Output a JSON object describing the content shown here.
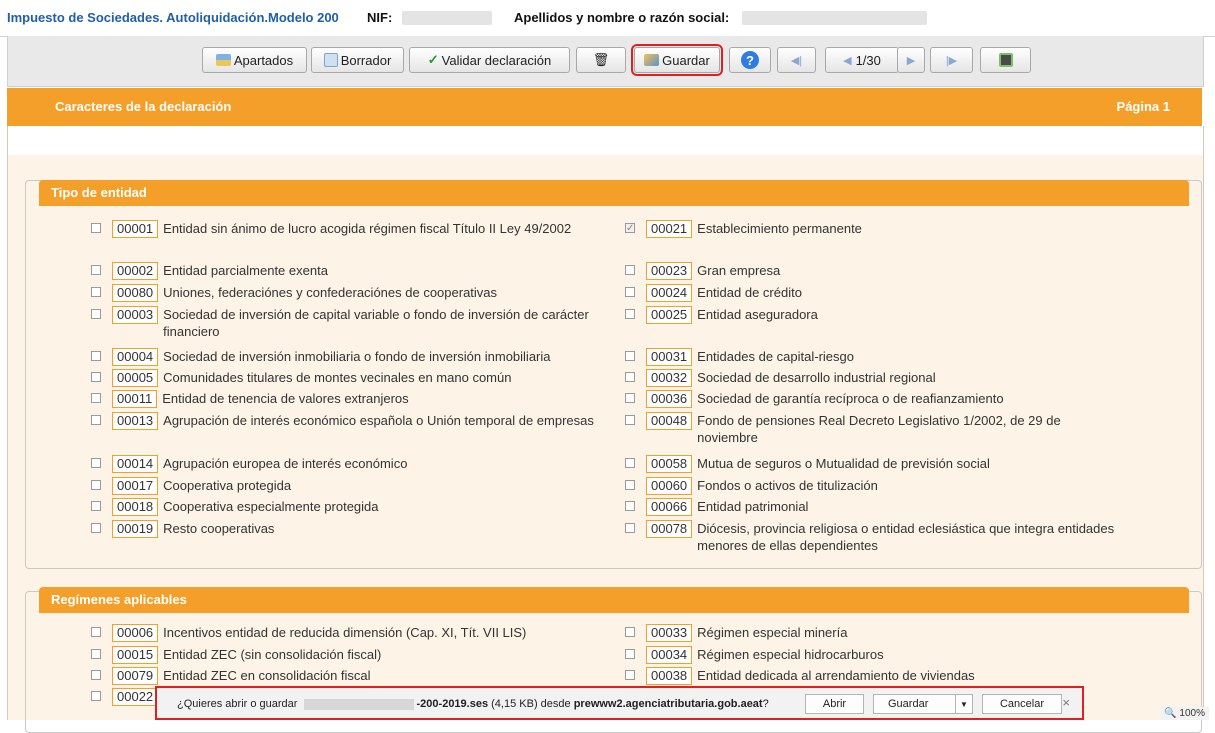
{
  "header": {
    "app_title": "Impuesto de Sociedades. Autoliquidación.Modelo 200",
    "nif_label": "NIF:",
    "name_label": "Apellidos y nombre o razón social:"
  },
  "toolbar": {
    "apartados": "Apartados",
    "borrador": "Borrador",
    "validar": "Validar declaración",
    "guardar": "Guardar",
    "page_indicator": "1/30"
  },
  "page_header": {
    "title": "Caracteres de la declaración",
    "page": "Página 1"
  },
  "sections": {
    "tipo": {
      "title": "Tipo de entidad",
      "left": [
        {
          "code": "00001",
          "label": "Entidad sin ánimo de lucro acogida régimen fiscal Título II Ley 49/2002",
          "checked": false
        },
        {
          "code": "00002",
          "label": "Entidad parcialmente exenta",
          "checked": false
        },
        {
          "code": "00080",
          "label": "Uniones, federaciónes y confederaciónes de cooperativas",
          "checked": false
        },
        {
          "code": "00003",
          "label": "Sociedad de inversión de capital variable o fondo de inversión de carácter financiero",
          "checked": false
        },
        {
          "code": "00004",
          "label": "Sociedad de inversión inmobiliaria o fondo de inversión inmobiliaria",
          "checked": false
        },
        {
          "code": "00005",
          "label": "Comunidades titulares de montes vecinales en mano común",
          "checked": false
        },
        {
          "code": "00011",
          "label": "Entidad de tenencia de valores extranjeros",
          "checked": false
        },
        {
          "code": "00013",
          "label": "Agrupación de interés económico española o Unión temporal de empresas",
          "checked": false
        },
        {
          "code": "00014",
          "label": "Agrupación europea de interés económico",
          "checked": false
        },
        {
          "code": "00017",
          "label": "Cooperativa protegida",
          "checked": false
        },
        {
          "code": "00018",
          "label": "Cooperativa especialmente protegida",
          "checked": false
        },
        {
          "code": "00019",
          "label": "Resto cooperativas",
          "checked": false
        }
      ],
      "right": [
        {
          "code": "00021",
          "label": "Establecimiento permanente",
          "checked": true
        },
        {
          "code": "00023",
          "label": "Gran empresa",
          "checked": false
        },
        {
          "code": "00024",
          "label": "Entidad de crédito",
          "checked": false
        },
        {
          "code": "00025",
          "label": "Entidad aseguradora",
          "checked": false
        },
        {
          "code": "00031",
          "label": "Entidades de capital-riesgo",
          "checked": false
        },
        {
          "code": "00032",
          "label": "Sociedad de desarrollo industrial regional",
          "checked": false
        },
        {
          "code": "00036",
          "label": "Sociedad de garantía recíproca o de reafianzamiento",
          "checked": false
        },
        {
          "code": "00048",
          "label": "Fondo de pensiones Real Decreto Legislativo 1/2002, de 29 de noviembre",
          "checked": false
        },
        {
          "code": "00058",
          "label": "Mutua de seguros o Mutualidad de previsión social",
          "checked": false
        },
        {
          "code": "00060",
          "label": "Fondos o activos de titulización",
          "checked": false
        },
        {
          "code": "00066",
          "label": "Entidad patrimonial",
          "checked": false
        },
        {
          "code": "00078",
          "label": "Diócesis, provincia religiosa o entidad eclesiástica que integra entidades menores de ellas dependientes",
          "checked": false
        }
      ]
    },
    "regimenes": {
      "title": "Regímenes aplicables",
      "left": [
        {
          "code": "00006",
          "label": "Incentivos entidad de reducida dimensión (Cap. XI, Tít. VII LIS)",
          "checked": false
        },
        {
          "code": "00015",
          "label": "Entidad ZEC (sin consolidación fiscal)",
          "checked": false
        },
        {
          "code": "00079",
          "label": "Entidad ZEC en consolidación fiscal",
          "checked": false
        },
        {
          "code": "00022",
          "label": "",
          "checked": false
        }
      ],
      "right": [
        {
          "code": "00033",
          "label": "Régimen especial minería",
          "checked": false
        },
        {
          "code": "00034",
          "label": "Régimen especial hidrocarburos",
          "checked": false
        },
        {
          "code": "00038",
          "label": "Entidad dedicada al arrendamiento de viviendas",
          "checked": false
        }
      ]
    }
  },
  "download_bar": {
    "prefix": "¿Quieres abrir o guardar",
    "file": "-200-2019.ses",
    "size": "(4,15 KB) desde",
    "domain": "prewww2.agenciatributaria.gob.aeat",
    "suffix": "?",
    "open": "Abrir",
    "save": "Guardar",
    "cancel": "Cancelar",
    "close": "×"
  },
  "zoom": "100%",
  "colors": {
    "accent": "#f39f2a",
    "title_blue": "#1f5fa8",
    "highlight": "#e02020"
  }
}
